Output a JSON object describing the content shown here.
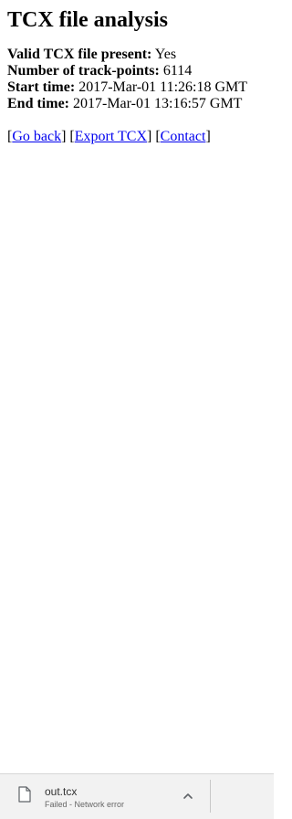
{
  "page": {
    "title": "TCX file analysis",
    "info": [
      {
        "label": "Valid TCX file present:",
        "value": "Yes"
      },
      {
        "label": "Number of track-points:",
        "value": "6114"
      },
      {
        "label": "Start time:",
        "value": "2017-Mar-01 11:26:18 GMT"
      },
      {
        "label": "End time:",
        "value": "2017-Mar-01 13:16:57 GMT"
      }
    ],
    "links": [
      {
        "label": "Go back"
      },
      {
        "label": "Export TCX"
      },
      {
        "label": "Contact"
      }
    ]
  },
  "download_shelf": {
    "item": {
      "file_name": "out.tcx",
      "status": "Failed - Network error",
      "icon": "file-icon"
    },
    "menu_icon": "chevron-up-icon"
  }
}
